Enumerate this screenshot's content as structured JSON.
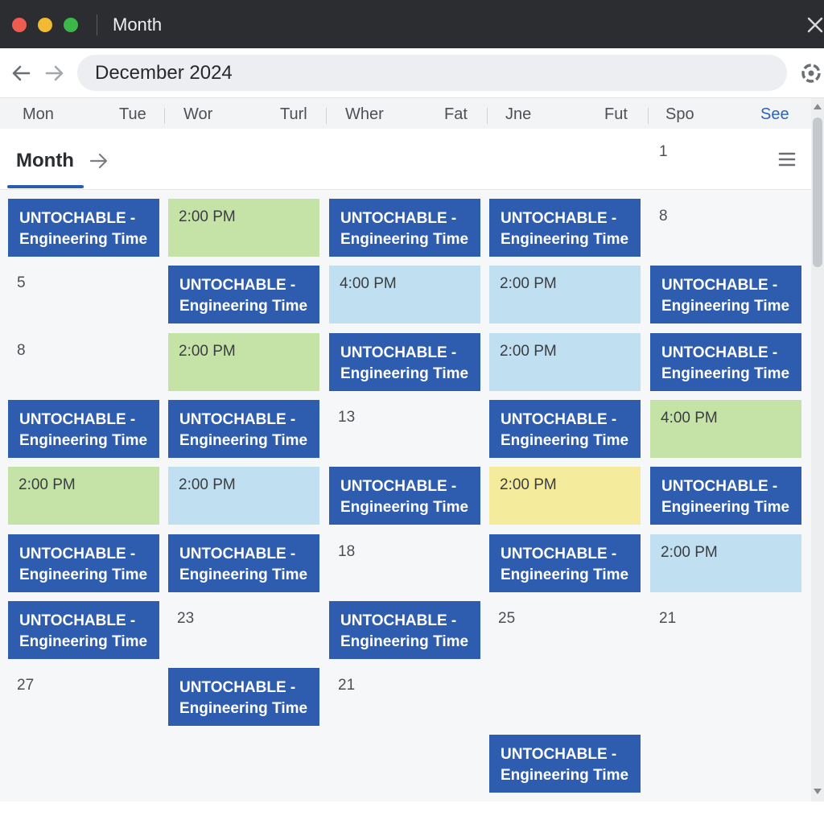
{
  "window": {
    "title": "Month"
  },
  "toolbar": {
    "address": "December 2024"
  },
  "weekdays": [
    "Mon",
    "Tue",
    "Wor",
    "Turl",
    "Wher",
    "Fat",
    "Jne",
    "Fut",
    "Spo",
    "See"
  ],
  "subheader": {
    "tab": "Month",
    "corner_day": "1"
  },
  "events": {
    "title_line1": "UNTOCHABLE -",
    "title_line2": "Engineering Time",
    "colors": {
      "blue": "#2e5caf",
      "green": "#c6e3a7",
      "light_blue": "#c0dff0",
      "yellow": "#f4ec9c"
    }
  },
  "grid": [
    [
      {
        "type": "event",
        "color": "blue"
      },
      {
        "type": "time",
        "color": "green",
        "time": "2:00 PM"
      },
      {
        "type": "event",
        "color": "blue"
      },
      {
        "type": "event",
        "color": "blue"
      },
      {
        "type": "day",
        "day": "8"
      }
    ],
    [
      {
        "type": "day",
        "day": "5"
      },
      {
        "type": "event",
        "color": "blue"
      },
      {
        "type": "time",
        "color": "light_blue",
        "time": "4:00 PM"
      },
      {
        "type": "time",
        "color": "light_blue",
        "time": "2:00 PM"
      },
      {
        "type": "event",
        "color": "blue"
      }
    ],
    [
      {
        "type": "day",
        "day": "8"
      },
      {
        "type": "time",
        "color": "green",
        "time": "2:00 PM"
      },
      {
        "type": "event",
        "color": "blue"
      },
      {
        "type": "time",
        "color": "light_blue",
        "time": "2:00 PM"
      },
      {
        "type": "event",
        "color": "blue"
      }
    ],
    [
      {
        "type": "event",
        "color": "blue"
      },
      {
        "type": "event",
        "color": "blue"
      },
      {
        "type": "day",
        "day": "13"
      },
      {
        "type": "event",
        "color": "blue"
      },
      {
        "type": "time",
        "color": "green",
        "time": "4:00 PM"
      }
    ],
    [
      {
        "type": "time",
        "color": "green",
        "time": "2:00 PM"
      },
      {
        "type": "time",
        "color": "light_blue",
        "time": "2:00 PM"
      },
      {
        "type": "event",
        "color": "blue"
      },
      {
        "type": "time",
        "color": "yellow",
        "time": "2:00 PM"
      },
      {
        "type": "event",
        "color": "blue"
      }
    ],
    [
      {
        "type": "event",
        "color": "blue"
      },
      {
        "type": "event",
        "color": "blue"
      },
      {
        "type": "day",
        "day": "18"
      },
      {
        "type": "event",
        "color": "blue"
      },
      {
        "type": "time",
        "color": "light_blue",
        "time": "2:00 PM"
      }
    ],
    [
      {
        "type": "event",
        "color": "blue"
      },
      {
        "type": "day",
        "day": "23"
      },
      {
        "type": "event",
        "color": "blue"
      },
      {
        "type": "day",
        "day": "25"
      },
      {
        "type": "day",
        "day": "21"
      }
    ],
    [
      {
        "type": "day",
        "day": "27"
      },
      {
        "type": "event",
        "color": "blue"
      },
      {
        "type": "day",
        "day": "21"
      },
      {
        "type": "empty"
      },
      {
        "type": "empty"
      }
    ],
    [
      {
        "type": "empty"
      },
      {
        "type": "empty"
      },
      {
        "type": "empty"
      },
      {
        "type": "event",
        "color": "blue"
      },
      {
        "type": "empty"
      }
    ]
  ]
}
